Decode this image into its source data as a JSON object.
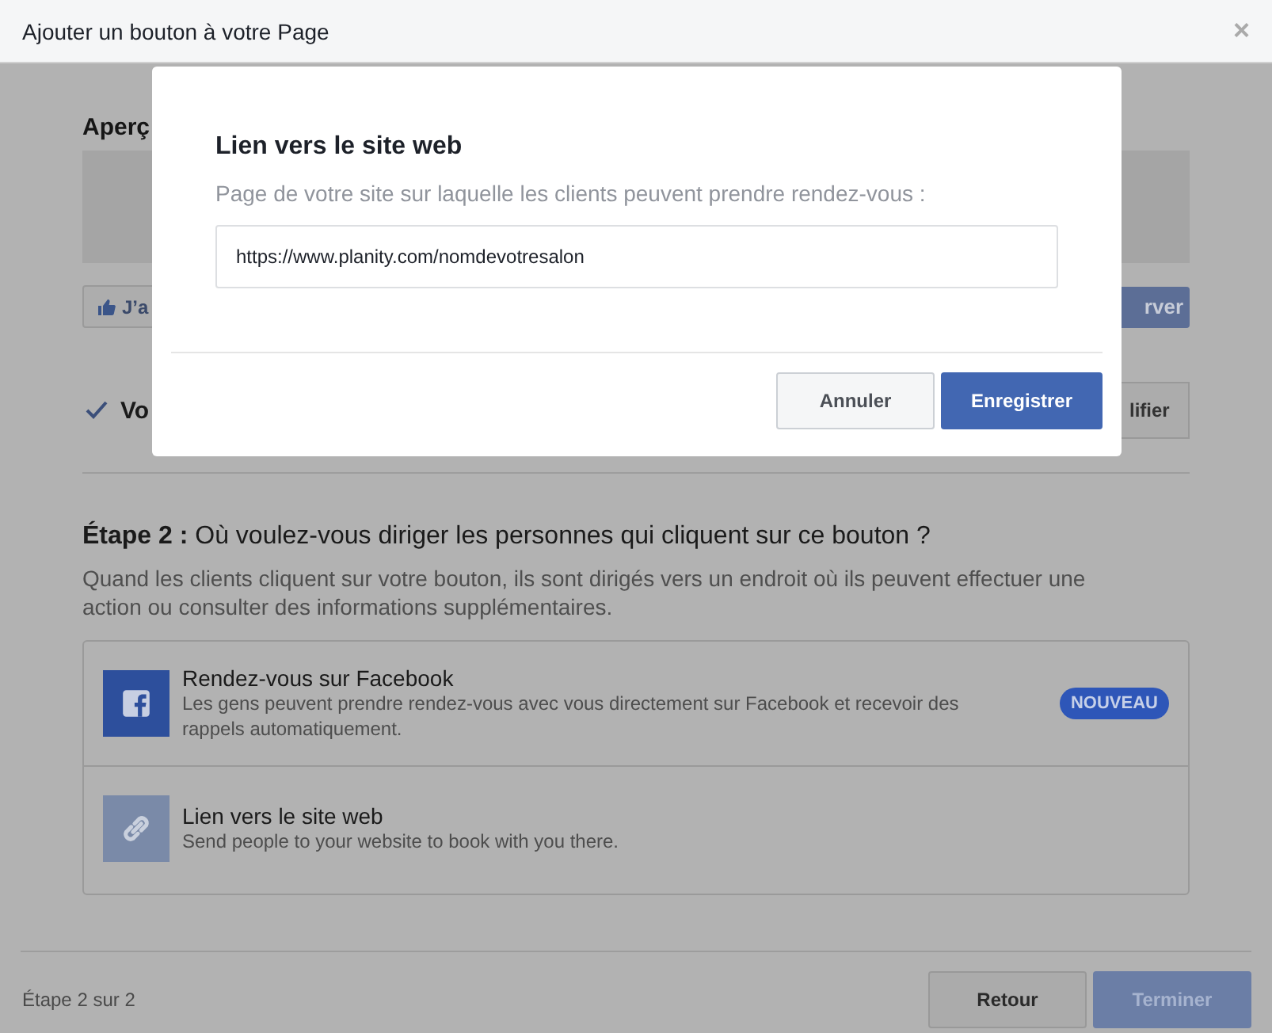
{
  "window": {
    "title": "Ajouter un bouton à votre Page",
    "close": "×"
  },
  "preview": {
    "heading": "Aperç",
    "like_button": "J’a",
    "action_button": "rver"
  },
  "step1": {
    "text": "Vo",
    "edit_button": "lifier",
    "done": true
  },
  "step2": {
    "heading": "**Étape 2 :** Où voulez-vous diriger les personnes qui cliquent sur ce bouton ?",
    "description": "Quand les clients cliquent sur votre bouton, ils sont dirigés vers un endroit où ils peuvent effectuer une action ou consulter des informations supplémentaires.",
    "options": [
      {
        "kind": "facebook",
        "title": "Rendez-vous sur Facebook",
        "subtitle": "Les gens peuvent prendre rendez-vous avec vous directement sur Facebook et recevoir des rappels automatiquement.",
        "badge": "NOUVEAU"
      },
      {
        "kind": "link",
        "title": "Lien vers le site web",
        "subtitle": "Send people to your website to book with you there."
      }
    ]
  },
  "footer": {
    "step": "Étape 2 sur 2",
    "back": "Retour",
    "finish": "Terminer"
  },
  "modal": {
    "title": "Lien vers le site web",
    "label": "Page de votre site sur laquelle les clients peuvent prendre rendez-vous :",
    "value": "https://www.planity.com/nomdevotresalon",
    "cancel": "Annuler",
    "save": "Enregistrer"
  }
}
